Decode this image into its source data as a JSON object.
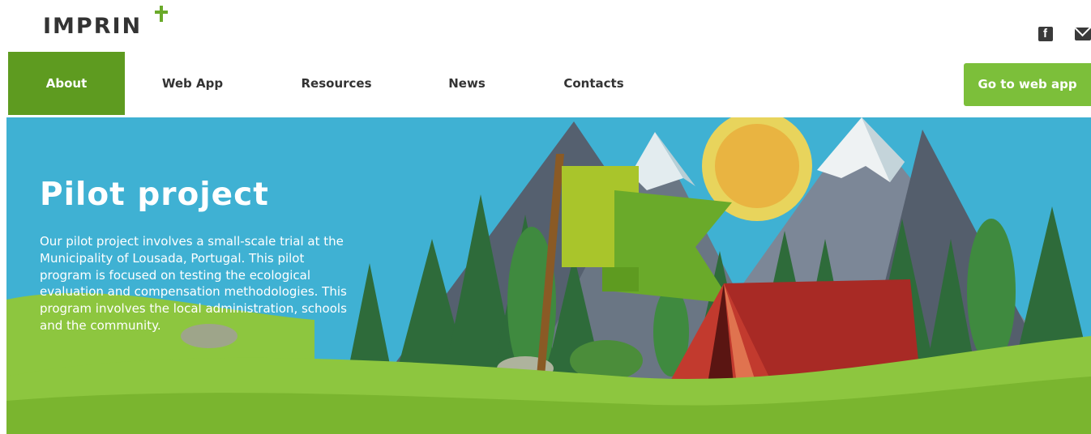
{
  "brand": {
    "logo_text": "IMPRIN",
    "logo_icon": "plus-icon"
  },
  "social": {
    "facebook_icon": "facebook-icon",
    "facebook_glyph": "f",
    "mail_icon": "mail-icon"
  },
  "nav": {
    "items": [
      {
        "label": "About",
        "active": true
      },
      {
        "label": "Web App",
        "active": false
      },
      {
        "label": "Resources",
        "active": false
      },
      {
        "label": "News",
        "active": false
      },
      {
        "label": "Contacts",
        "active": false
      }
    ],
    "cta_label": "Go to web app"
  },
  "hero": {
    "title": "Pilot project",
    "body": "Our pilot project involves a small-scale trial at the Municipality of Lousada, Portugal. This pilot program is focused on testing the ecological evaluation and compensation methodologies. This program involves the local administration, schools and the community."
  },
  "colors": {
    "primary_green": "#5e9b20",
    "cta_green": "#7cbf3a",
    "sky": "#3fb1d3",
    "ground": "#8dc63f",
    "tent": "#a82a25"
  }
}
